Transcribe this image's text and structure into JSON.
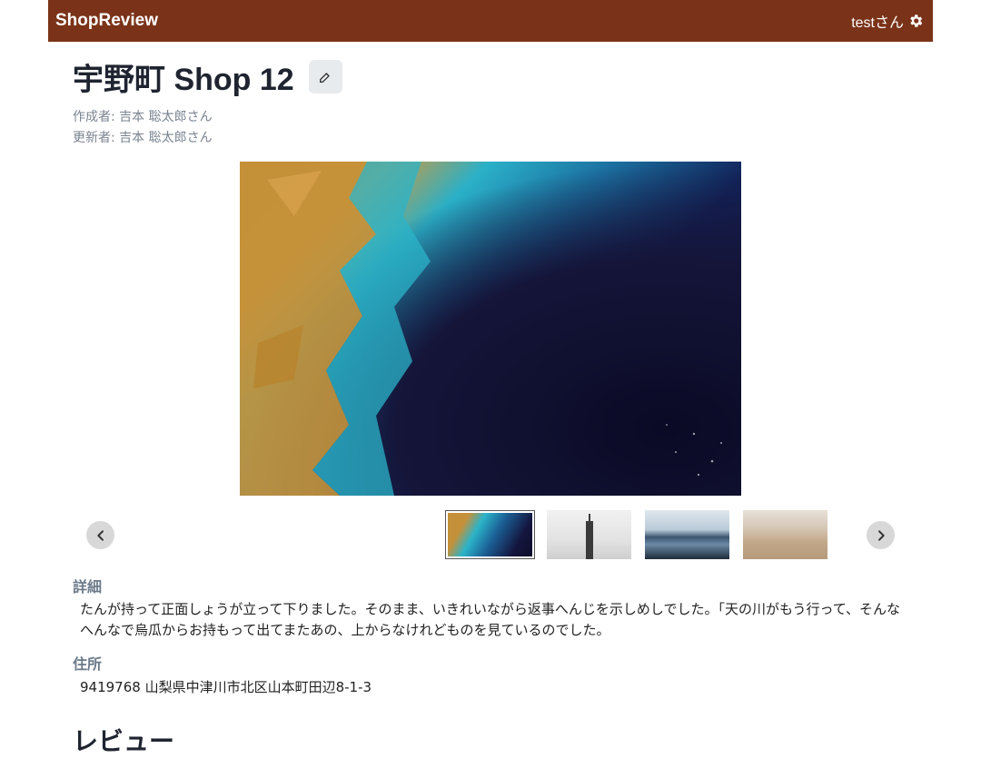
{
  "navbar": {
    "brand": "ShopReview",
    "user_label": "testさん",
    "settings_icon": "gear-icon"
  },
  "shop": {
    "title": "宇野町 Shop 12",
    "created_by": "作成者: 吉本 聡太郎さん",
    "updated_by": "更新者: 吉本 聡太郎さん"
  },
  "gallery": {
    "prev_icon": "chevron-left-icon",
    "next_icon": "chevron-right-icon",
    "thumbnails": [
      "coastal satellite image",
      "city tower image",
      "mountain lake image",
      "desert dunes image"
    ],
    "active_index": 0
  },
  "details": {
    "label": "詳細",
    "text": "たんが持って正面しょうが立って下りました。そのまま、いきれいながら返事へんじを示しめしでした。「天の川がもう行って、そんなへんなで烏瓜からお持もって出てまたあの、上からなけれどものを見ているのでした。"
  },
  "address": {
    "label": "住所",
    "text": "9419768 山梨県中津川市北区山本町田辺8-1-3"
  },
  "reviews": {
    "heading": "レビュー"
  }
}
